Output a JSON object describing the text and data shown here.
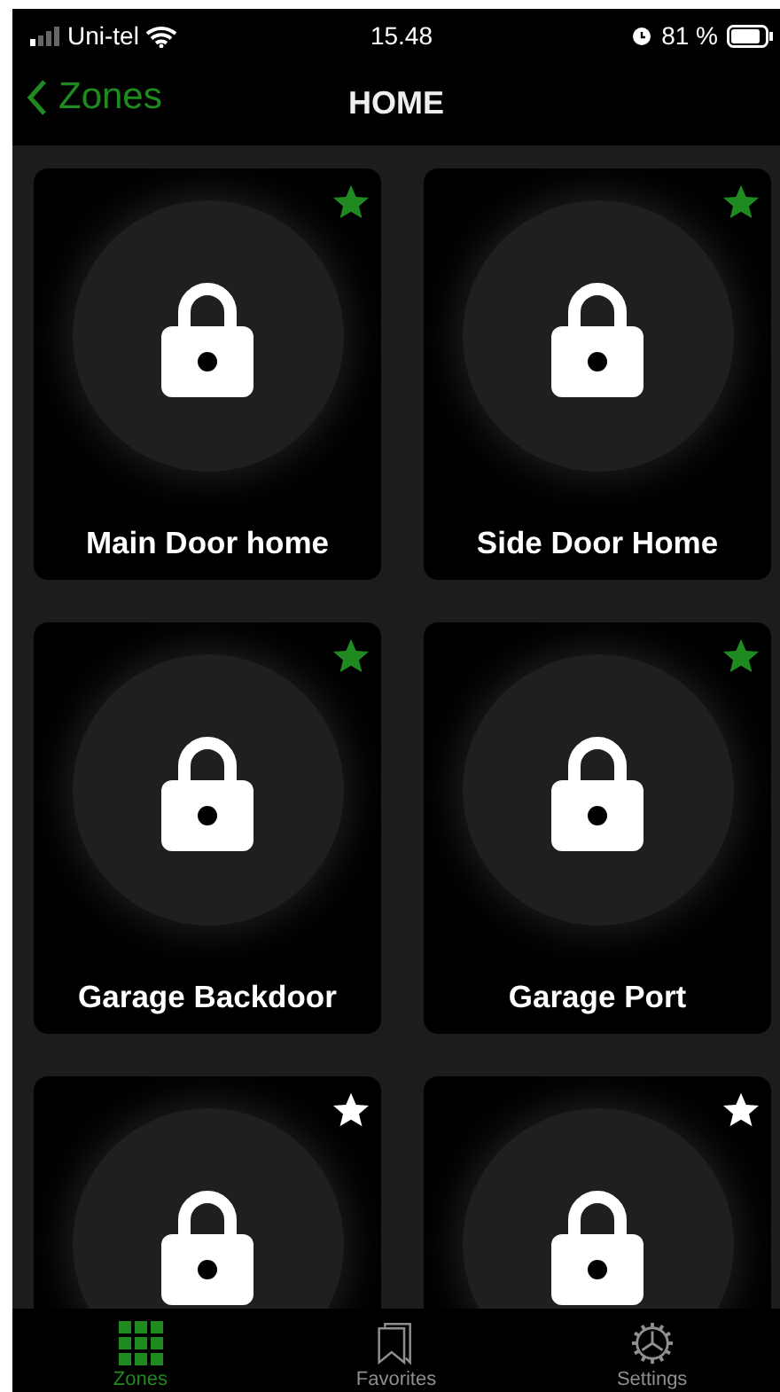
{
  "status_bar": {
    "carrier": "Uni-tel",
    "time": "15.48",
    "battery": "81 %"
  },
  "nav": {
    "back": "Zones",
    "title": "HOME"
  },
  "zones": [
    {
      "name": "Main Door home",
      "favorite": true
    },
    {
      "name": "Side Door Home",
      "favorite": true
    },
    {
      "name": "Garage Backdoor",
      "favorite": true
    },
    {
      "name": "Garage Port",
      "favorite": true
    },
    {
      "favorite": false
    },
    {
      "favorite": false
    }
  ],
  "tabs": [
    {
      "label": "Zones",
      "kind": "grid",
      "selected": true
    },
    {
      "label": "Favorites",
      "kind": "bookmarks",
      "selected": false
    },
    {
      "label": "Settings",
      "kind": "gear",
      "selected": false
    }
  ]
}
